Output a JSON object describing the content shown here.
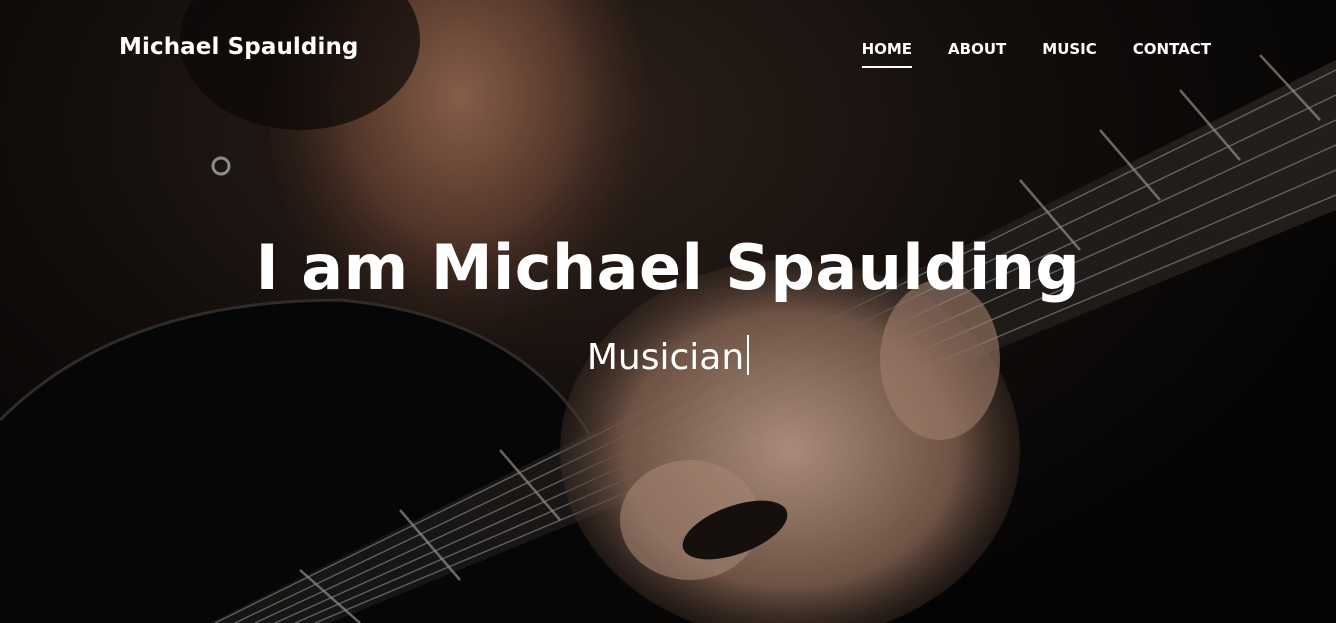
{
  "header": {
    "brand": "Michael Spaulding",
    "nav": [
      {
        "label": "HOME",
        "active": true
      },
      {
        "label": "ABOUT",
        "active": false
      },
      {
        "label": "MUSIC",
        "active": false
      },
      {
        "label": "CONTACT",
        "active": false
      }
    ]
  },
  "hero": {
    "title": "I am Michael Spaulding",
    "subtitle": "Musician"
  }
}
